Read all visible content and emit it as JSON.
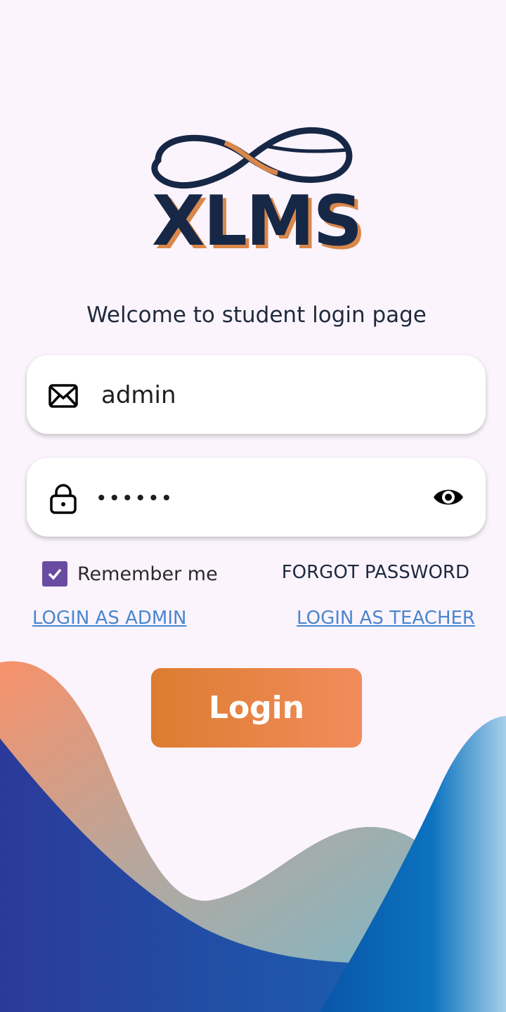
{
  "brand": {
    "name": "XLMS"
  },
  "welcome_text": "Welcome to student login page",
  "email": {
    "value": "admin",
    "icon": "envelope-icon"
  },
  "password": {
    "value": "••••••",
    "icon": "lock-icon",
    "toggle_icon": "eye-icon"
  },
  "remember": {
    "label": "Remember me",
    "checked": true
  },
  "forgot_password": "FORGOT PASSWORD",
  "links": {
    "admin": "LOGIN AS ADMIN",
    "teacher": "LOGIN AS TEACHER"
  },
  "login_button": "Login",
  "colors": {
    "background": "#fbf4fc",
    "brand_navy": "#172746",
    "brand_orange": "#d9874a",
    "checkbox": "#6a4ba2",
    "link": "#4a86cf",
    "button_start": "#dc7c30",
    "button_end": "#f28c5c"
  }
}
